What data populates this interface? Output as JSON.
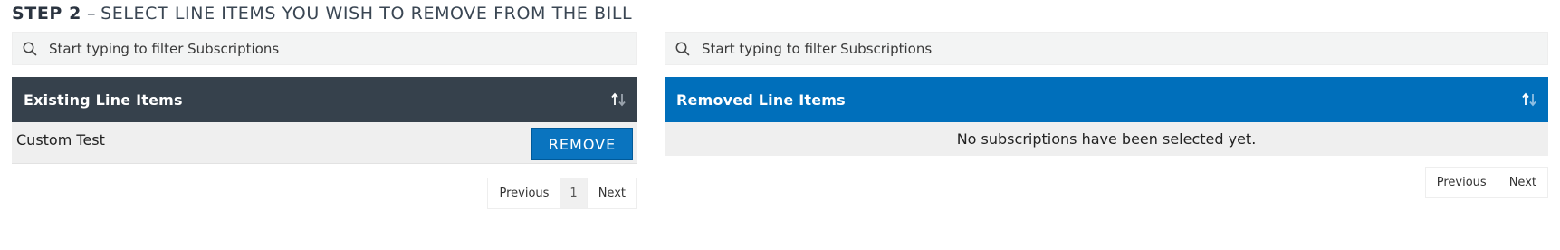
{
  "heading": {
    "step": "STEP 2",
    "dash": "–",
    "text": "SELECT LINE ITEMS YOU WISH TO REMOVE FROM THE BILL"
  },
  "existing": {
    "filter_placeholder": "Start typing to filter Subscriptions",
    "header_title": "Existing Line Items",
    "rows": [
      {
        "name": "Custom Test",
        "action_label": "REMOVE"
      }
    ],
    "pager": {
      "previous": "Previous",
      "page": "1",
      "next": "Next"
    }
  },
  "removed": {
    "filter_placeholder": "Start typing to filter Subscriptions",
    "header_title": "Removed Line Items",
    "empty_message": "No subscriptions have been selected yet.",
    "pager": {
      "previous": "Previous",
      "next": "Next"
    }
  },
  "icons": {
    "search": "search-icon",
    "sort": "sort-icon"
  },
  "colors": {
    "existing_header": "#36414c",
    "removed_header": "#006fbb",
    "remove_button": "#0a74bf",
    "row_background": "#efefef"
  }
}
